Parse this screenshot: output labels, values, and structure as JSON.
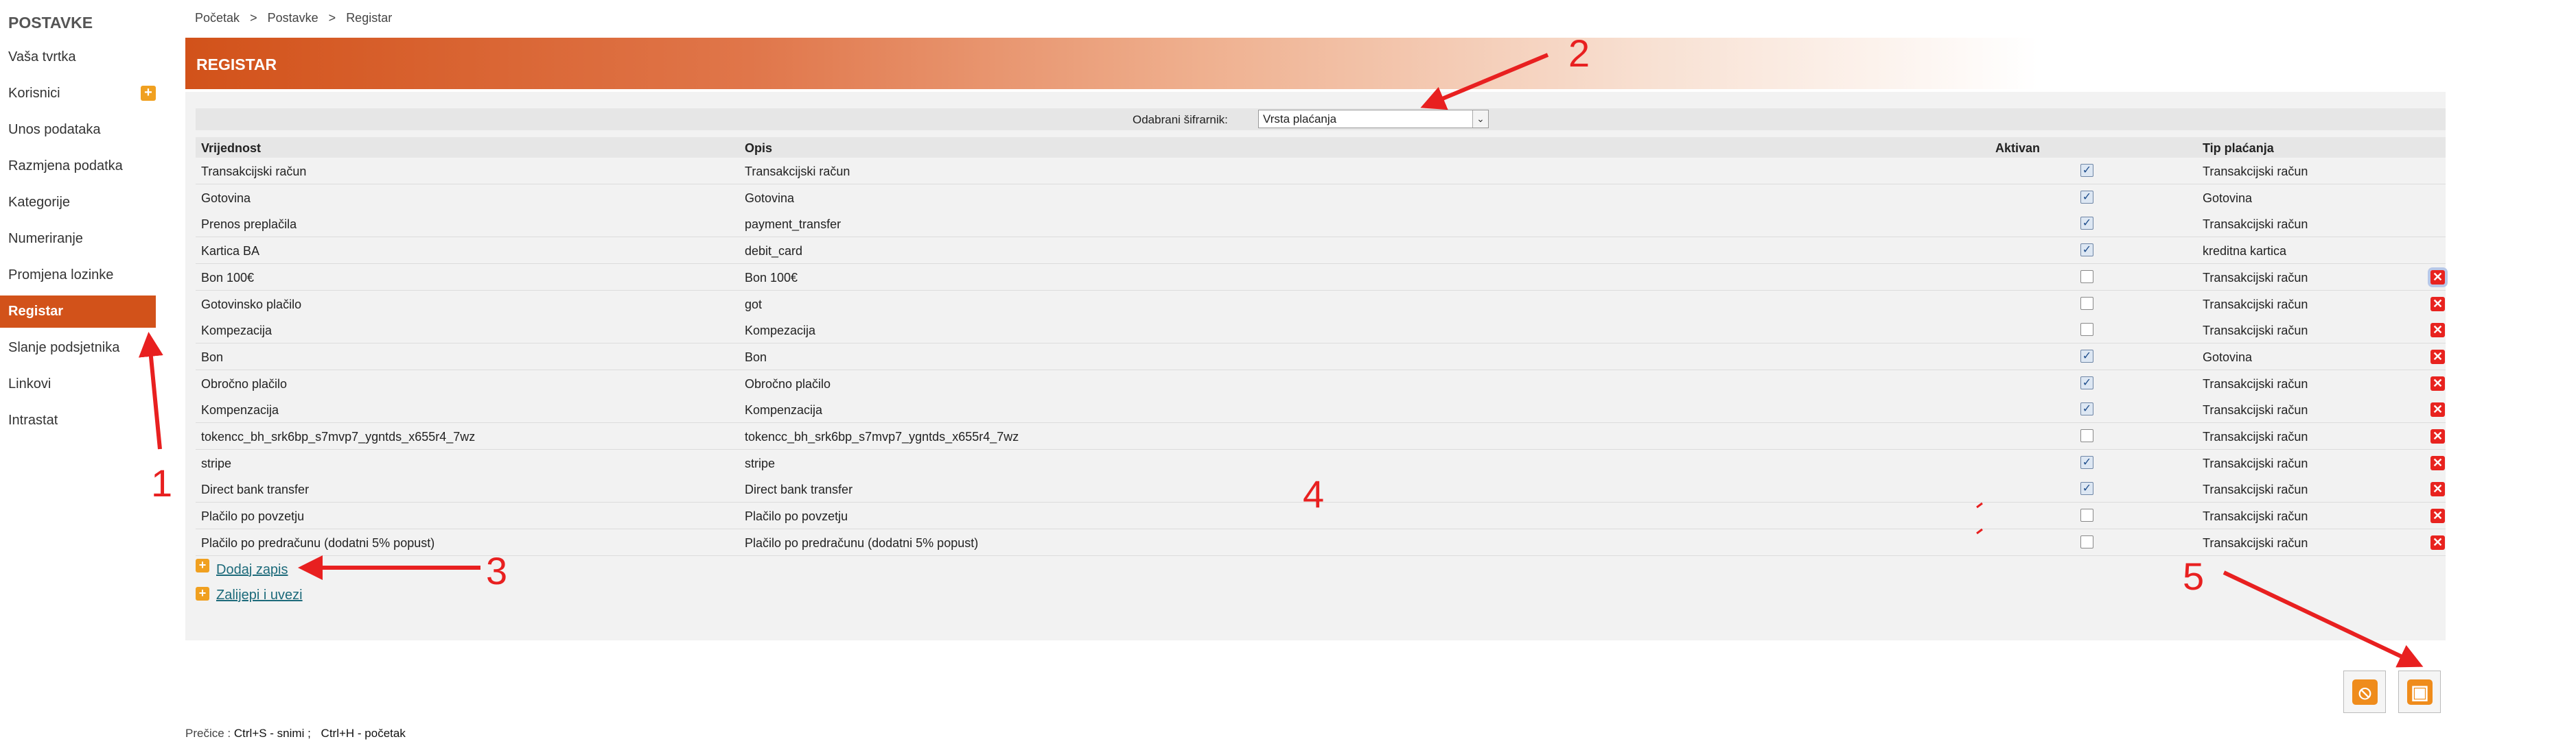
{
  "sidebar": {
    "title": "POSTAVKE",
    "plus_icon": "+",
    "items": [
      {
        "label": "Vaša tvrtka"
      },
      {
        "label": "Korisnici"
      },
      {
        "label": "Unos podataka"
      },
      {
        "label": "Razmjena podatka"
      },
      {
        "label": "Kategorije"
      },
      {
        "label": "Numeriranje"
      },
      {
        "label": "Promjena lozinke"
      },
      {
        "label": "Registar",
        "active": true
      },
      {
        "label": "Slanje podsjetnika"
      },
      {
        "label": "Linkovi"
      },
      {
        "label": "Intrastat"
      }
    ]
  },
  "breadcrumb": {
    "items": [
      "Početak",
      ">",
      "Postavke",
      ">",
      "Registar"
    ]
  },
  "header": {
    "title": "REGISTAR"
  },
  "filter": {
    "label": "Odabrani šifrarnik:",
    "value": "Vrsta plaćanja",
    "arrow": "⌄"
  },
  "table": {
    "headers": [
      "Vrijednost",
      "Opis",
      "Aktivan",
      "Tip plaćanja"
    ],
    "rows": [
      {
        "value": "Transakcijski račun",
        "desc": "Transakcijski račun",
        "active": true,
        "type": "Transakcijski račun",
        "delete": false
      },
      {
        "value": "Gotovina",
        "desc": "Gotovina",
        "active": true,
        "type": "Gotovina",
        "delete": false
      },
      {
        "value": "Prenos preplačila",
        "desc": "payment_transfer",
        "active": true,
        "type": "Transakcijski račun",
        "delete": false
      },
      {
        "value": "Kartica BA",
        "desc": "debit_card",
        "active": true,
        "type": "kreditna kartica",
        "delete": false
      },
      {
        "value": "Bon 100€",
        "desc": "Bon 100€",
        "active": false,
        "type": "Transakcijski račun",
        "delete": true
      },
      {
        "value": "Gotovinsko plačilo",
        "desc": "got",
        "active": false,
        "type": "Transakcijski račun",
        "delete": true
      },
      {
        "value": "Kompezacija",
        "desc": "Kompezacija",
        "active": false,
        "type": "Transakcijski račun",
        "delete": true
      },
      {
        "value": "Bon",
        "desc": "Bon",
        "active": true,
        "type": "Gotovina",
        "delete": true
      },
      {
        "value": "Obročno plačilo",
        "desc": "Obročno plačilo",
        "active": true,
        "type": "Transakcijski račun",
        "delete": true
      },
      {
        "value": "Kompenzacija",
        "desc": "Kompenzacija",
        "active": true,
        "type": "Transakcijski račun",
        "delete": true
      },
      {
        "value": "tokencc_bh_srk6bp_s7mvp7_ygntds_x655r4_7wz",
        "desc": "tokencc_bh_srk6bp_s7mvp7_ygntds_x655r4_7wz",
        "active": false,
        "type": "Transakcijski račun",
        "delete": true
      },
      {
        "value": "stripe",
        "desc": "stripe",
        "active": true,
        "type": "Transakcijski račun",
        "delete": true
      },
      {
        "value": "Direct bank transfer",
        "desc": "Direct bank transfer",
        "active": true,
        "type": "Transakcijski račun",
        "delete": true
      },
      {
        "value": "Plačilo po povzetju",
        "desc": "Plačilo po povzetju",
        "active": false,
        "type": "Transakcijski račun",
        "delete": true
      },
      {
        "value": "Plačilo po predračunu (dodatni 5% popust)",
        "desc": "Plačilo po predračunu (dodatni 5% popust)",
        "active": false,
        "type": "Transakcijski račun",
        "delete": true
      }
    ],
    "check_glyph": "✓",
    "delete_glyph": "✕"
  },
  "actions": {
    "add_record": "Dodaj zapis",
    "paste_import": "Zalijepi i uvezi",
    "add_icon": "+"
  },
  "buttons": {
    "cancel_icon": "⦸",
    "save_icon": "▣"
  },
  "shortcuts": {
    "label": "Prečice :",
    "save": "Ctrl+S - snimi ;",
    "home": "Ctrl+H - početak"
  },
  "annotations": [
    "1",
    "2",
    "3",
    "4",
    "5"
  ],
  "colors": {
    "accent": "#d2521a",
    "delete": "#e8231f",
    "add": "#f0a020",
    "annotation": "#e82020",
    "link": "#1c6a7a"
  }
}
